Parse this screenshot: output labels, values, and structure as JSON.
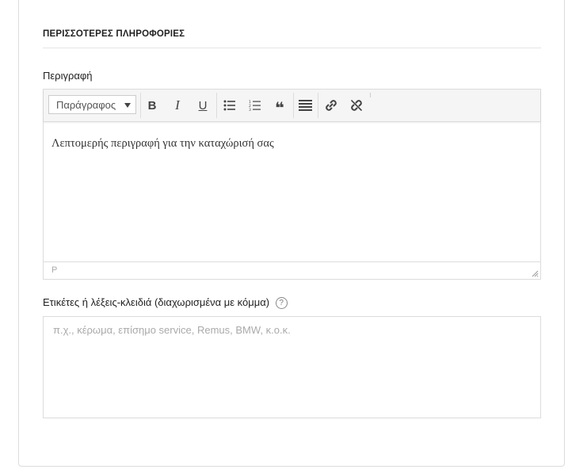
{
  "section": {
    "title": "ΠΕΡΙΣΣΟΤΕΡΕΣ ΠΛΗΡΟΦΟΡΙΕΣ"
  },
  "description": {
    "label": "Περιγραφή",
    "format_value": "Παράγραφος",
    "content": "Λεπτομερής περιγραφή για την καταχώρισή σας",
    "status_path": "P",
    "toolbar": {
      "bold": "B",
      "italic": "I",
      "underline": "U",
      "quote": "❝"
    }
  },
  "tags": {
    "label": "Ετικέτες ή λέξεις-κλειδιά (διαχωρισμένα με κόμμα)",
    "help": "?",
    "placeholder": "π.χ., κέρωμα, επίσημο service, Remus, BMW, κ.ο.κ.",
    "value": ""
  },
  "icons": {
    "bullet_list": "bullet-list-icon",
    "numbered_list": "numbered-list-icon",
    "align": "align-justify-icon",
    "link": "link-icon",
    "unlink": "unlink-icon"
  }
}
